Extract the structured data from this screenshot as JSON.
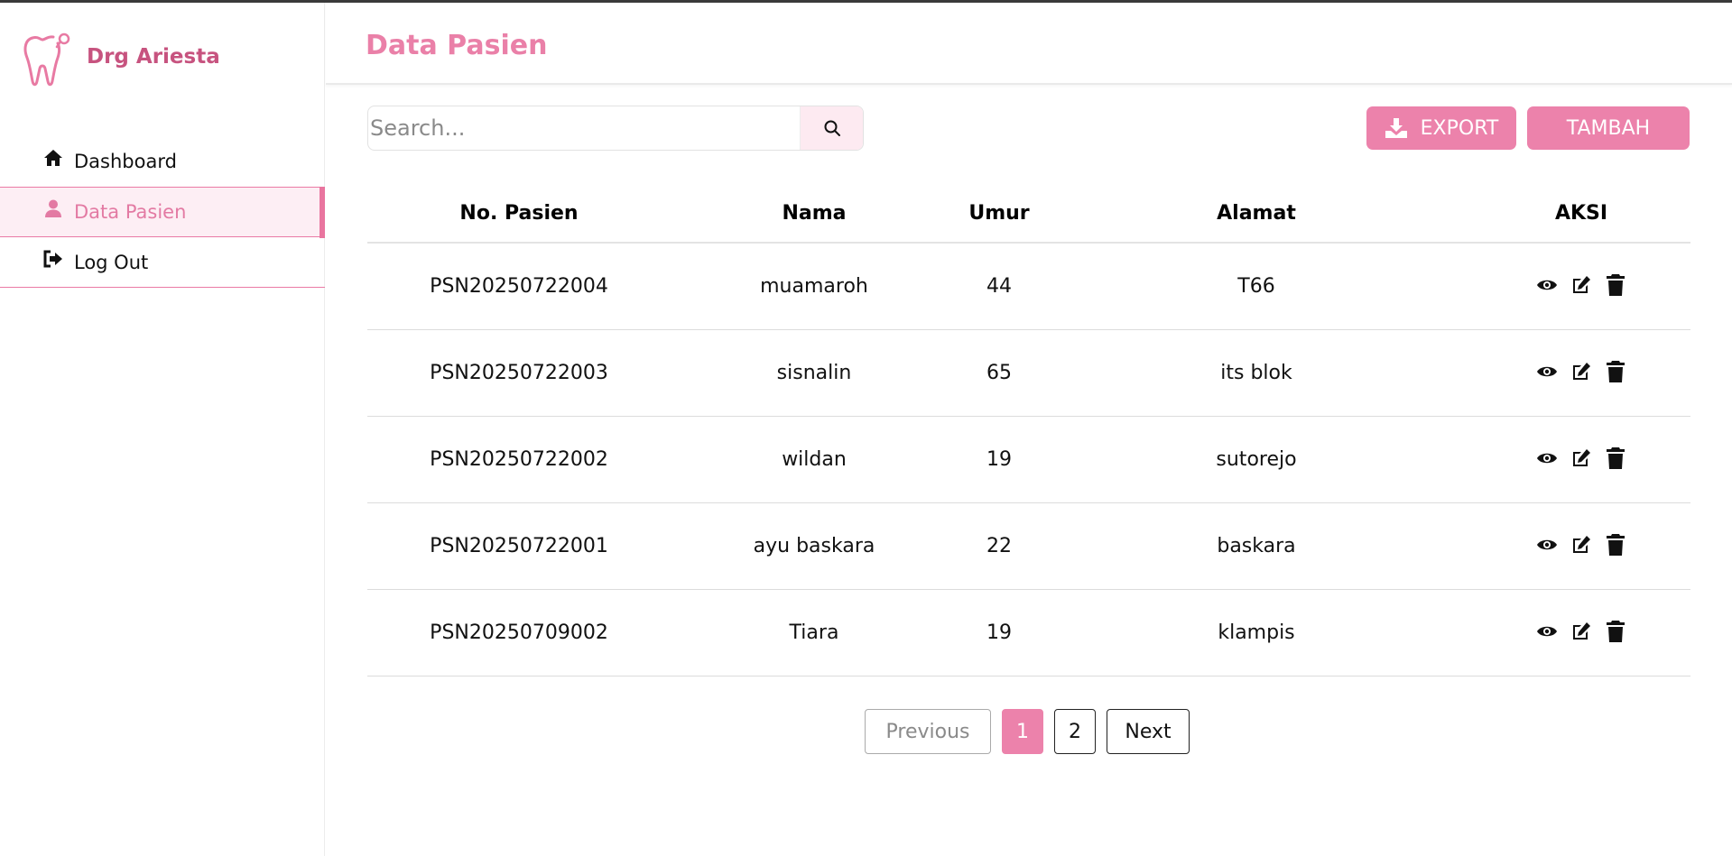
{
  "sidebar": {
    "brand": "Drg Ariesta",
    "items": [
      {
        "label": "Dashboard",
        "icon": "home-icon"
      },
      {
        "label": "Data Pasien",
        "icon": "user-icon",
        "active": true
      },
      {
        "label": "Log Out",
        "icon": "sign-out-icon"
      }
    ]
  },
  "header": {
    "title": "Data Pasien"
  },
  "toolbar": {
    "search_placeholder": "Search...",
    "export_label": "EXPORT",
    "add_label": "TAMBAH"
  },
  "table": {
    "columns": [
      "No. Pasien",
      "Nama",
      "Umur",
      "Alamat",
      "AKSI"
    ],
    "rows": [
      {
        "no": "PSN20250722004",
        "nama": "muamaroh",
        "umur": "44",
        "alamat": "T66"
      },
      {
        "no": "PSN20250722003",
        "nama": "sisnalin",
        "umur": "65",
        "alamat": "its blok"
      },
      {
        "no": "PSN20250722002",
        "nama": "wildan",
        "umur": "19",
        "alamat": "sutorejo"
      },
      {
        "no": "PSN20250722001",
        "nama": "ayu baskara",
        "umur": "22",
        "alamat": "baskara"
      },
      {
        "no": "PSN20250709002",
        "nama": "Tiara",
        "umur": "19",
        "alamat": "klampis"
      }
    ],
    "action_icons": [
      "eye-icon",
      "edit-icon",
      "trash-icon"
    ]
  },
  "pagination": {
    "previous": "Previous",
    "pages": [
      "1",
      "2"
    ],
    "current": "1",
    "next": "Next"
  },
  "colors": {
    "accent": "#ec82ab",
    "brand_text": "#c7537f",
    "active_bg": "#fdeef4"
  }
}
